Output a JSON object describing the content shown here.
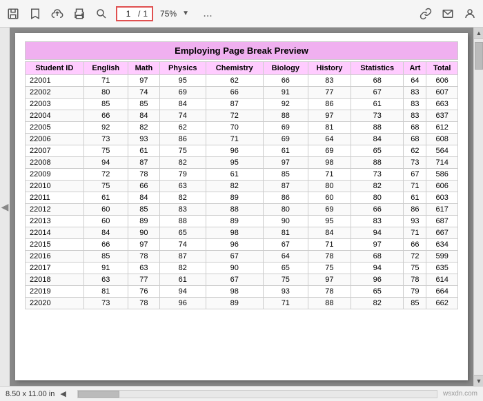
{
  "toolbar": {
    "page_current": "1",
    "page_sep": "/",
    "page_total": "1",
    "zoom": "75%",
    "more_label": "..."
  },
  "document": {
    "title": "Employing Page Break Preview",
    "columns": [
      "Student ID",
      "English",
      "Math",
      "Physics",
      "Chemistry",
      "Biology",
      "History",
      "Statistics",
      "Art",
      "Total"
    ],
    "rows": [
      [
        "22001",
        "71",
        "97",
        "95",
        "62",
        "66",
        "83",
        "68",
        "64",
        "606"
      ],
      [
        "22002",
        "80",
        "74",
        "69",
        "66",
        "91",
        "77",
        "67",
        "83",
        "607"
      ],
      [
        "22003",
        "85",
        "85",
        "84",
        "87",
        "92",
        "86",
        "61",
        "83",
        "663"
      ],
      [
        "22004",
        "66",
        "84",
        "74",
        "72",
        "88",
        "97",
        "73",
        "83",
        "637"
      ],
      [
        "22005",
        "92",
        "82",
        "62",
        "70",
        "69",
        "81",
        "88",
        "68",
        "612"
      ],
      [
        "22006",
        "73",
        "93",
        "86",
        "71",
        "69",
        "64",
        "84",
        "68",
        "608"
      ],
      [
        "22007",
        "75",
        "61",
        "75",
        "96",
        "61",
        "69",
        "65",
        "62",
        "564"
      ],
      [
        "22008",
        "94",
        "87",
        "82",
        "95",
        "97",
        "98",
        "88",
        "73",
        "714"
      ],
      [
        "22009",
        "72",
        "78",
        "79",
        "61",
        "85",
        "71",
        "73",
        "67",
        "586"
      ],
      [
        "22010",
        "75",
        "66",
        "63",
        "82",
        "87",
        "80",
        "82",
        "71",
        "606"
      ],
      [
        "22011",
        "61",
        "84",
        "82",
        "89",
        "86",
        "60",
        "80",
        "61",
        "603"
      ],
      [
        "22012",
        "60",
        "85",
        "83",
        "88",
        "80",
        "69",
        "66",
        "86",
        "617"
      ],
      [
        "22013",
        "60",
        "89",
        "88",
        "89",
        "90",
        "95",
        "83",
        "93",
        "687"
      ],
      [
        "22014",
        "84",
        "90",
        "65",
        "98",
        "81",
        "84",
        "94",
        "71",
        "667"
      ],
      [
        "22015",
        "66",
        "97",
        "74",
        "96",
        "67",
        "71",
        "97",
        "66",
        "634"
      ],
      [
        "22016",
        "85",
        "78",
        "87",
        "67",
        "64",
        "78",
        "68",
        "72",
        "599"
      ],
      [
        "22017",
        "91",
        "63",
        "82",
        "90",
        "65",
        "75",
        "94",
        "75",
        "635"
      ],
      [
        "22018",
        "63",
        "77",
        "61",
        "67",
        "75",
        "97",
        "96",
        "78",
        "614"
      ],
      [
        "22019",
        "81",
        "76",
        "94",
        "98",
        "93",
        "78",
        "65",
        "79",
        "664"
      ],
      [
        "22020",
        "73",
        "78",
        "96",
        "89",
        "71",
        "88",
        "82",
        "85",
        "662"
      ]
    ]
  },
  "bottom": {
    "page_size": "8.50 x 11.00 in",
    "watermark": "wsxdn.com"
  }
}
